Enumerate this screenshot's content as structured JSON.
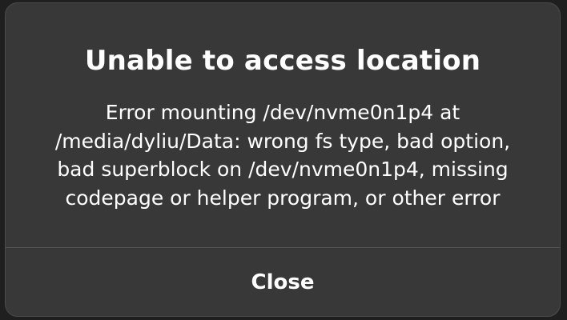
{
  "dialog": {
    "title": "Unable to access location",
    "message": "Error mounting /dev/nvme0n1p4 at /media/dyliu/Data: wrong fs type, bad option, bad superblock on /dev/nvme0n1p4, missing codepage or helper program, or other error",
    "close_label": "Close"
  },
  "colors": {
    "backdrop": "#1f1f1f",
    "dialog_bg": "#383838",
    "text": "#ffffff",
    "divider": "#545454"
  }
}
